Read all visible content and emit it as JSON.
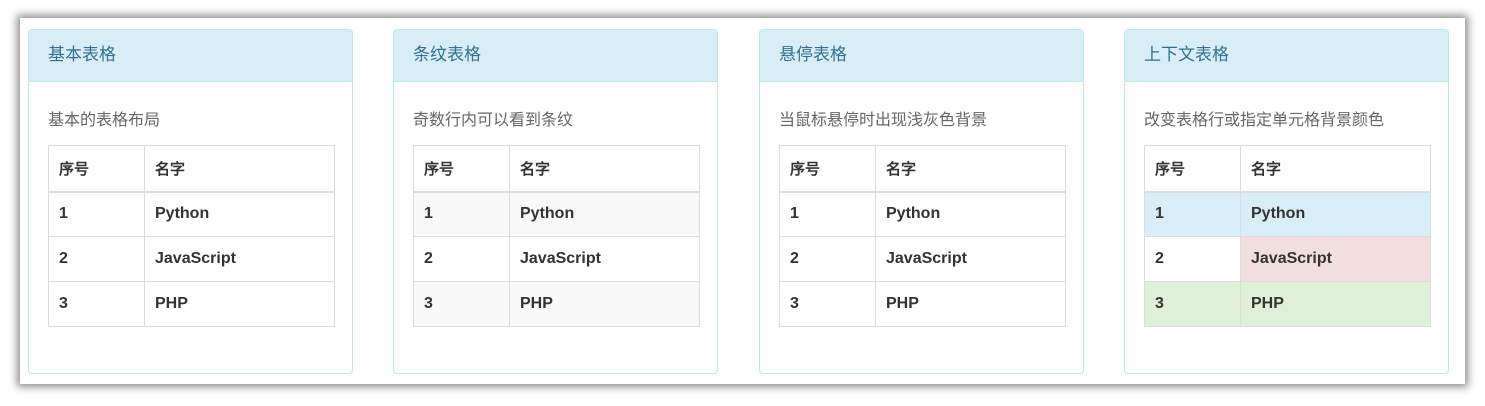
{
  "headers": [
    "序号",
    "名字"
  ],
  "panels": [
    {
      "title": "基本表格",
      "description": "基本的表格布局",
      "rows": [
        [
          "1",
          "Python"
        ],
        [
          "2",
          "JavaScript"
        ],
        [
          "3",
          "PHP"
        ]
      ]
    },
    {
      "title": "条纹表格",
      "description": "奇数行内可以看到条纹",
      "rows": [
        [
          "1",
          "Python"
        ],
        [
          "2",
          "JavaScript"
        ],
        [
          "3",
          "PHP"
        ]
      ]
    },
    {
      "title": "悬停表格",
      "description": "当鼠标悬停时出现浅灰色背景",
      "rows": [
        [
          "1",
          "Python"
        ],
        [
          "2",
          "JavaScript"
        ],
        [
          "3",
          "PHP"
        ]
      ]
    },
    {
      "title": "上下文表格",
      "description": "改变表格行或指定单元格背景颜色",
      "rows": [
        [
          "1",
          "Python"
        ],
        [
          "2",
          "JavaScript"
        ],
        [
          "3",
          "PHP"
        ]
      ]
    }
  ],
  "colors": {
    "heading_bg": "#d9edf7",
    "heading_text": "#31708f",
    "panel_border": "#bce8f1",
    "stripe": "#f9f9f9",
    "info": "#d9edf7",
    "danger": "#f2dede",
    "success": "#dff0d8"
  }
}
